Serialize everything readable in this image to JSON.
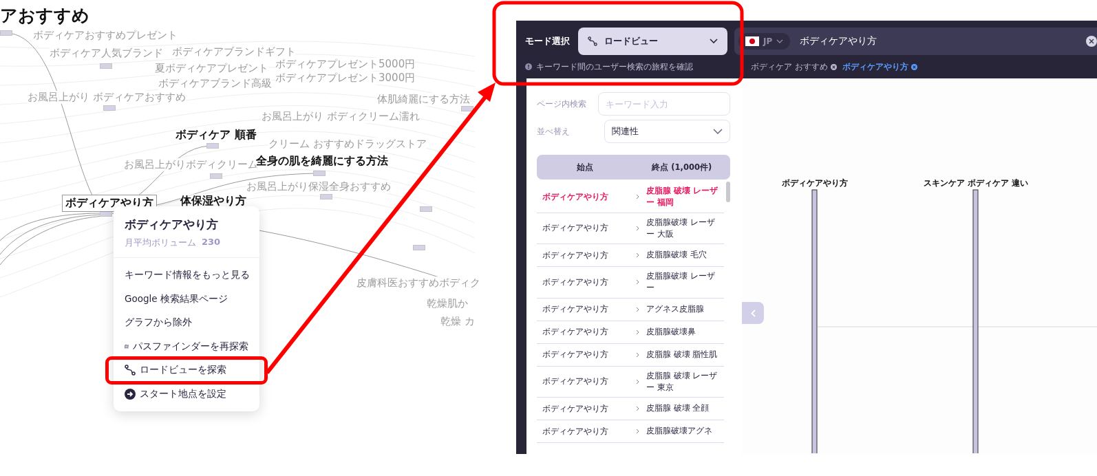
{
  "graph": {
    "title_fragment": "アおすすめ",
    "background_keywords": [
      "ボディケアおすすめプレゼント",
      "ボディケア人気ブランド",
      "ボディケアブランドギフト",
      "夏ボディケアプレゼント",
      "ボディケアプレゼント5000円",
      "ボディケアプレゼント3000円",
      "ボディケアブランド高級",
      "お風呂上がり ボディケアおすすめ",
      "体肌綺麗にする方法",
      "お風呂上がり ボディクリーム濡れ",
      "クリーム おすすめドラッグストア",
      "お風呂上がりボディクリーム",
      "お風呂上がり保湿全身おすすめ",
      "皮膚科医おすすめボディク",
      "乾燥肌か",
      "乾燥 カ"
    ],
    "nodes": [
      {
        "label": "ボディケア 順番",
        "boxed": false
      },
      {
        "label": "全身の肌を綺麗にする方法",
        "boxed": false
      },
      {
        "label": "ボディケアやり方",
        "boxed": true
      },
      {
        "label": "体保湿やり方",
        "boxed": false
      }
    ]
  },
  "context_menu": {
    "title": "ボディケアやり方",
    "volume_label": "月平均ボリューム",
    "volume_value": "230",
    "items": [
      {
        "label": "キーワード情報をもっと見る",
        "kind": "plain",
        "highlighted": false
      },
      {
        "label": "Google 検索結果ページ",
        "kind": "plain",
        "highlighted": false
      },
      {
        "label": "グラフから除外",
        "kind": "plain",
        "highlighted": false
      },
      {
        "label": "パスファインダーを再探索",
        "kind": "map",
        "highlighted": false
      },
      {
        "label": "ロードビューを探索",
        "kind": "route",
        "highlighted": true
      },
      {
        "label": "スタート地点を設定",
        "kind": "start",
        "highlighted": false
      }
    ]
  },
  "road_view": {
    "mode_label": "モード選択",
    "mode_value": "ロードビュー",
    "search": {
      "country": "JP",
      "value": "ボディケアやり方"
    },
    "hint": "キーワード間のユーザー検索の旅程を確認",
    "tags": [
      {
        "label": "ボディケア おすすめ",
        "selected": false
      },
      {
        "label": "ボディケアやり方",
        "selected": true
      }
    ],
    "filter": {
      "label": "ページ内検索",
      "placeholder": "キーワード入力"
    },
    "sort": {
      "label": "並べ替え",
      "value": "関連性"
    },
    "columns": [
      "始点",
      "終点 (1,000件)"
    ],
    "rows": [
      {
        "start": "ボディケアやり方",
        "end": "皮脂腺 破壊 レーザー 福岡",
        "selected": true
      },
      {
        "start": "ボディケアやり方",
        "end": "皮脂腺破壊 レーザー 大阪",
        "selected": false
      },
      {
        "start": "ボディケアやり方",
        "end": "皮脂腺破壊 毛穴",
        "selected": false
      },
      {
        "start": "ボディケアやり方",
        "end": "皮脂腺破壊 レーザー",
        "selected": false
      },
      {
        "start": "ボディケアやり方",
        "end": "アグネス皮脂腺",
        "selected": false
      },
      {
        "start": "ボディケアやり方",
        "end": "皮脂腺破壊鼻",
        "selected": false
      },
      {
        "start": "ボディケアやり方",
        "end": "皮脂腺 破壊 脂性肌",
        "selected": false
      },
      {
        "start": "ボディケアやり方",
        "end": "皮脂腺 破壊 レーザー 東京",
        "selected": false
      },
      {
        "start": "ボディケアやり方",
        "end": "皮脂腺 破壊 全顔",
        "selected": false
      },
      {
        "start": "ボディケアやり方",
        "end": "皮脂腺破壊アグネ",
        "selected": false
      }
    ],
    "path_labels": [
      "ボディケアやり方",
      "スキンケア ボディケア 違い"
    ]
  }
}
